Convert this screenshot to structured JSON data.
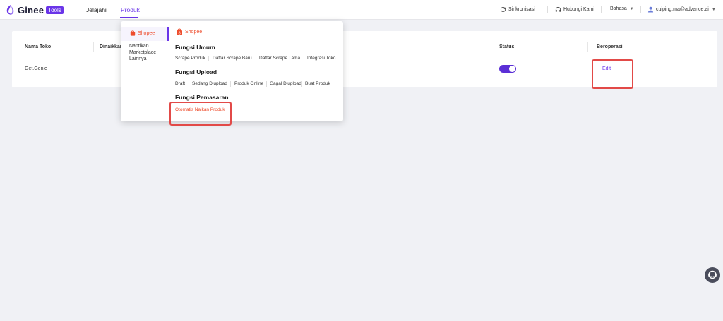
{
  "brand": {
    "name": "Ginee",
    "badge": "Tools",
    "accent": "#6a35e8"
  },
  "nav": {
    "items": [
      "Jelajahi",
      "Produk"
    ],
    "active": "Produk"
  },
  "header_right": {
    "sync": "Sinkronisasi",
    "contact": "Hubungi Kami",
    "language": "Bahasa",
    "user": "cuiping.ma@advance.ai"
  },
  "table": {
    "headers": [
      "Nama Toko",
      "Dinaikkan",
      "Status",
      "Beroperasi"
    ],
    "rows": [
      {
        "name": "Get.Genie",
        "status_on": true,
        "action": "Edit"
      }
    ]
  },
  "dropdown": {
    "left_items": [
      "Shopee",
      "Nantikan Marketplace Lainnya"
    ],
    "shop_header": "Shopee",
    "sections": [
      {
        "title": "Fungsi Umum",
        "links": [
          "Scrape Produk",
          "Daftar Scrape Baru",
          "Daftar Scrape Lama",
          "Integrasi Toko"
        ]
      },
      {
        "title": "Fungsi Upload",
        "links": [
          "Draft",
          "Sedang Diupload",
          "Produk Online",
          "Gagal Diupload",
          "Buat Produk"
        ]
      },
      {
        "title": "Fungsi Pemasaran",
        "links": [
          "Otomatis Naikan Produk"
        ]
      }
    ]
  },
  "colors": {
    "shopee": "#ee4d2d",
    "highlight": "#e24a48",
    "toggle": "#5b2fd6"
  }
}
